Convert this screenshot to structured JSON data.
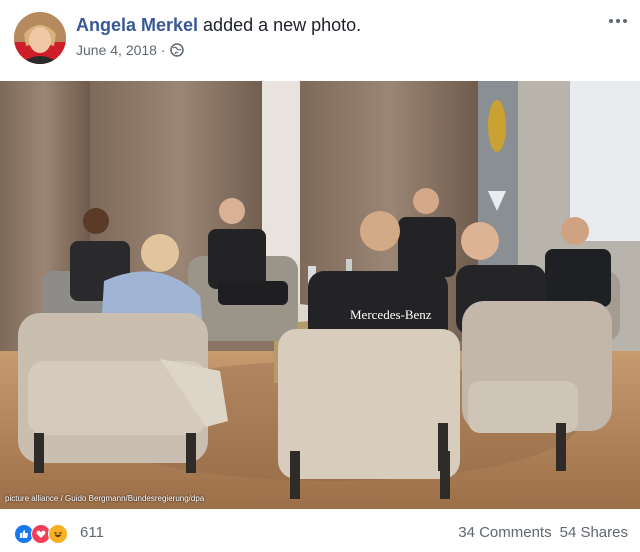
{
  "post": {
    "author": "Angela Merkel",
    "action": " added a new photo.",
    "date": "June 4, 2018 ·",
    "privacy_icon": "globe-icon",
    "menu_icon": "ellipsis-icon"
  },
  "photo": {
    "credit": "picture alliance / Guido Bergmann/Bundesregierung/dpa",
    "shirt_text": "Mercedes-Benz"
  },
  "footer": {
    "reactions": [
      "like-icon",
      "love-icon",
      "haha-icon"
    ],
    "reaction_count": "611",
    "comments": "34 Comments",
    "shares": "54 Shares"
  },
  "colors": {
    "link": "#385898",
    "like": "#1877f2",
    "love": "#f33e58",
    "haha": "#f7b125"
  }
}
